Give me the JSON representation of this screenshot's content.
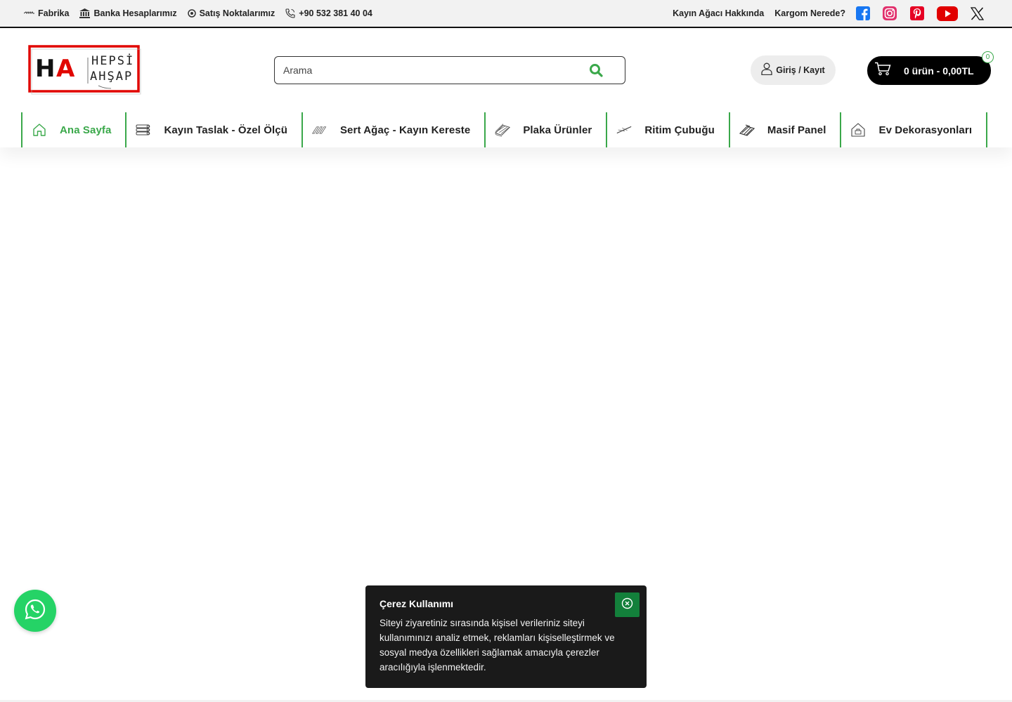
{
  "topbar": {
    "links": [
      {
        "label": "Fabrika",
        "icon": "saw-icon"
      },
      {
        "label": "Banka Hesaplarımız",
        "icon": "bank-icon"
      },
      {
        "label": "Satış Noktalarımız",
        "icon": "location-dot-icon"
      },
      {
        "label": "+90 532 381 40 04",
        "icon": "phone-icon"
      }
    ],
    "right_links": [
      "Kayın Ağacı Hakkında",
      "Kargom Nerede?"
    ],
    "social": [
      {
        "name": "facebook-icon",
        "color": "#1877f2"
      },
      {
        "name": "instagram-icon",
        "color": "#e1306c"
      },
      {
        "name": "pinterest-icon",
        "color": "#e60023"
      },
      {
        "name": "youtube-icon",
        "color": "#ff0000"
      },
      {
        "name": "x-icon",
        "color": "#111111"
      }
    ]
  },
  "header": {
    "logo": {
      "line1": "HEPSİ",
      "line2": "AHŞAP",
      "mark": "HA"
    },
    "search": {
      "placeholder": "Arama"
    },
    "login_label": "Giriş / Kayıt",
    "cart_label": "0 ürün - 0,00TL",
    "cart_count": "0"
  },
  "nav": {
    "items": [
      {
        "label": "Ana Sayfa",
        "icon": "home-icon",
        "active": true
      },
      {
        "label": "Kayın Taslak - Özel Ölçü",
        "icon": "lumber-stack-icon"
      },
      {
        "label": "Sert Ağaç - Kayın Kereste",
        "icon": "planks-icon"
      },
      {
        "label": "Plaka Ürünler",
        "icon": "board-icon"
      },
      {
        "label": "Ritim Çubuğu",
        "icon": "stick-icon"
      },
      {
        "label": "Masif Panel",
        "icon": "panel-icon"
      },
      {
        "label": "Ev Dekorasyonları",
        "icon": "house-decor-icon"
      }
    ]
  },
  "cookie": {
    "title": "Çerez Kullanımı",
    "text": "Siteyi ziyaretiniz sırasında kişisel verileriniz siteyi kullanımınızı analiz etmek, reklamları kişiselleştirmek ve sosyal medya özellikleri sağlamak amacıyla çerezler aracılığıyla işlenmektedir."
  },
  "colors": {
    "accent_green": "#3aa84a",
    "cookie_close": "#13803b",
    "whatsapp": "#25d366",
    "logo_red": "#e10600"
  }
}
